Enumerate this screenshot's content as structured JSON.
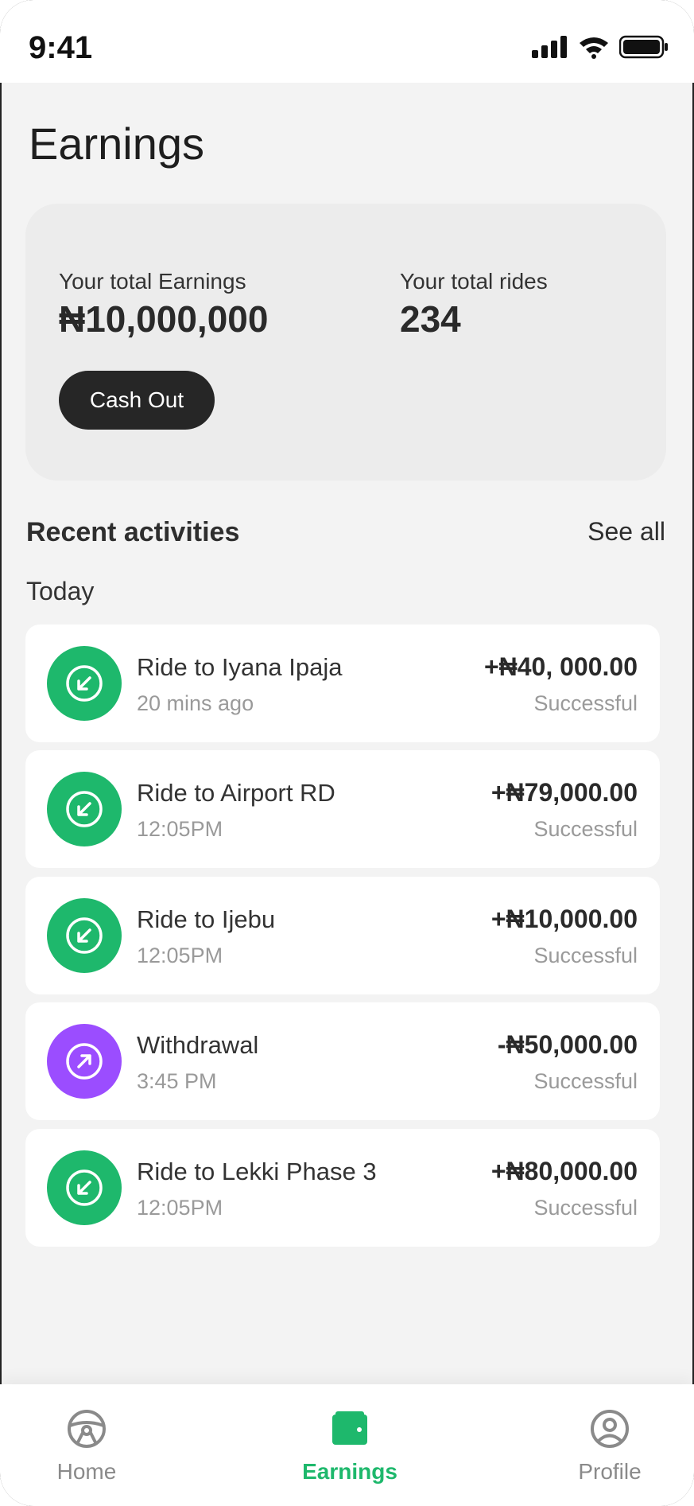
{
  "status": {
    "time": "9:41"
  },
  "page": {
    "title": "Earnings"
  },
  "summary": {
    "earnings_label": "Your total Earnings",
    "earnings_value": "₦10,000,000",
    "rides_label": "Your total rides",
    "rides_value": "234",
    "cash_out_label": "Cash Out"
  },
  "activities_section": {
    "title": "Recent activities",
    "see_all": "See all",
    "day": "Today"
  },
  "activities": [
    {
      "title": "Ride to Iyana Ipaja",
      "time": "20 mins ago",
      "amount": "+₦40, 000.00",
      "status": "Successful",
      "kind": "incoming",
      "icon": "arrow-down-left-icon"
    },
    {
      "title": "Ride to Airport RD",
      "time": "12:05PM",
      "amount": "+₦79,000.00",
      "status": "Successful",
      "kind": "incoming",
      "icon": "arrow-down-left-icon"
    },
    {
      "title": "Ride to Ijebu",
      "time": "12:05PM",
      "amount": "+₦10,000.00",
      "status": "Successful",
      "kind": "incoming",
      "icon": "arrow-down-left-icon"
    },
    {
      "title": "Withdrawal",
      "time": "3:45 PM",
      "amount": "-₦50,000.00",
      "status": "Successful",
      "kind": "outgoing",
      "icon": "arrow-up-right-icon"
    },
    {
      "title": "Ride to Lekki Phase 3",
      "time": "12:05PM",
      "amount": "+₦80,000.00",
      "status": "Successful",
      "kind": "incoming",
      "icon": "arrow-down-left-icon"
    }
  ],
  "nav": {
    "items": [
      {
        "label": "Home",
        "icon": "steering-wheel-icon"
      },
      {
        "label": "Earnings",
        "icon": "wallet-icon",
        "active": true
      },
      {
        "label": "Profile",
        "icon": "user-circle-icon"
      }
    ]
  },
  "colors": {
    "incoming": "#1eb86c",
    "outgoing": "#9b4dff",
    "accent": "#1eb86c",
    "dark": "#262626"
  }
}
